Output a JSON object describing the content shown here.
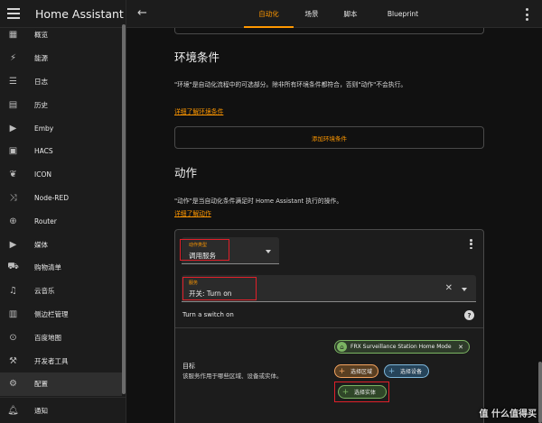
{
  "sidebar": {
    "title": "Home Assistant",
    "items": [
      {
        "label": "概览",
        "icon": "dashboard-icon",
        "glyph": "▦",
        "active": false
      },
      {
        "label": "能源",
        "icon": "lightning-icon",
        "glyph": "⚡",
        "active": false
      },
      {
        "label": "日志",
        "icon": "list-icon",
        "glyph": "☰",
        "active": false
      },
      {
        "label": "历史",
        "icon": "chart-icon",
        "glyph": "▤",
        "active": false
      },
      {
        "label": "Emby",
        "icon": "emby-icon",
        "glyph": "▶",
        "active": false
      },
      {
        "label": "HACS",
        "icon": "hacs-store-icon",
        "glyph": "▣",
        "active": false
      },
      {
        "label": "ICON",
        "icon": "leaf-icon",
        "glyph": "❦",
        "active": false
      },
      {
        "label": "Node-RED",
        "icon": "shuffle-icon",
        "glyph": "⤨",
        "active": false
      },
      {
        "label": "Router",
        "icon": "router-icon",
        "glyph": "⊕",
        "active": false
      },
      {
        "label": "媒体",
        "icon": "media-icon",
        "glyph": "▶",
        "active": false
      },
      {
        "label": "购物清单",
        "icon": "cart-icon",
        "glyph": "⛟",
        "active": false
      },
      {
        "label": "云音乐",
        "icon": "music-icon",
        "glyph": "♫",
        "active": false
      },
      {
        "label": "侧边栏管理",
        "icon": "panel-icon",
        "glyph": "▥",
        "active": false
      },
      {
        "label": "百度地图",
        "icon": "map-pin-icon",
        "glyph": "⊙",
        "active": false
      },
      {
        "label": "开发者工具",
        "icon": "hammer-icon",
        "glyph": "⚒",
        "active": false
      },
      {
        "label": "配置",
        "icon": "gear-icon",
        "glyph": "⚙",
        "active": true
      }
    ],
    "notifications_label": "通知"
  },
  "topbar": {
    "tabs": [
      {
        "label": "自动化",
        "active": true
      },
      {
        "label": "场景",
        "active": false
      },
      {
        "label": "脚本",
        "active": false
      },
      {
        "label": "Blueprint",
        "active": false
      }
    ]
  },
  "conditions": {
    "title": "环境条件",
    "description": "\"环境\"是自动化流程中的可选部分。除非所有环境条件都符合，否则\"动作\"不会执行。",
    "learn_more": "详细了解环境条件",
    "add_button": "添加环境条件"
  },
  "actions": {
    "title": "动作",
    "description": "\"动作\"是当自动化条件满足时 Home Assistant 执行的操作。",
    "learn_more": "详细了解动作",
    "card": {
      "type_label": "动作类型",
      "type_value": "调用服务",
      "service_label": "服务",
      "service_value": "开关: Turn on",
      "service_description": "Turn a switch on",
      "target_title": "目标",
      "target_description": "该服务作用于哪些区域、设备或实体。",
      "target_entity": "FRX Surveillance Station Home Mode",
      "add_area": "选择区域",
      "add_device": "选择设备",
      "add_entity": "选择实体"
    }
  },
  "watermark": "值 什么值得买",
  "colors": {
    "accent": "#ff9800",
    "highlight_box": "#e0202a",
    "entity_chip": "#7bb462",
    "area_chip": "#f4a460",
    "device_chip": "#7fb8dc"
  }
}
